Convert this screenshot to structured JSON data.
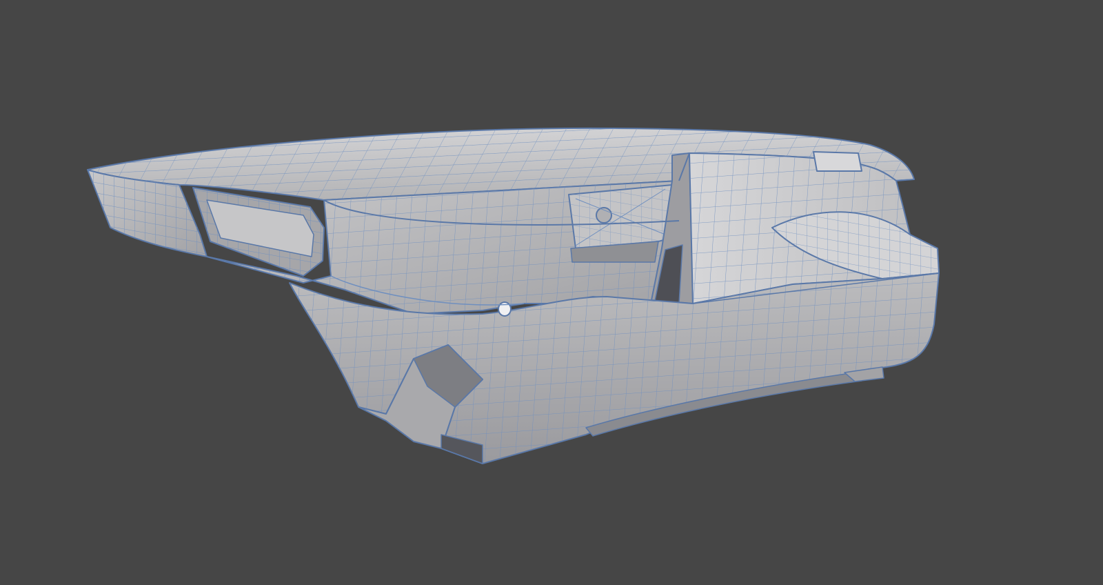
{
  "scene": {
    "background_color": "#464646",
    "model_fill_color": "#b9b9bb",
    "model_highlight_color": "#dadadc",
    "model_shadow_color": "#8e8f93",
    "wireframe_color": "#6f8fbf",
    "wireframe_edge_color": "#5a78a8",
    "model_description": "wireframe-mesh-object"
  }
}
